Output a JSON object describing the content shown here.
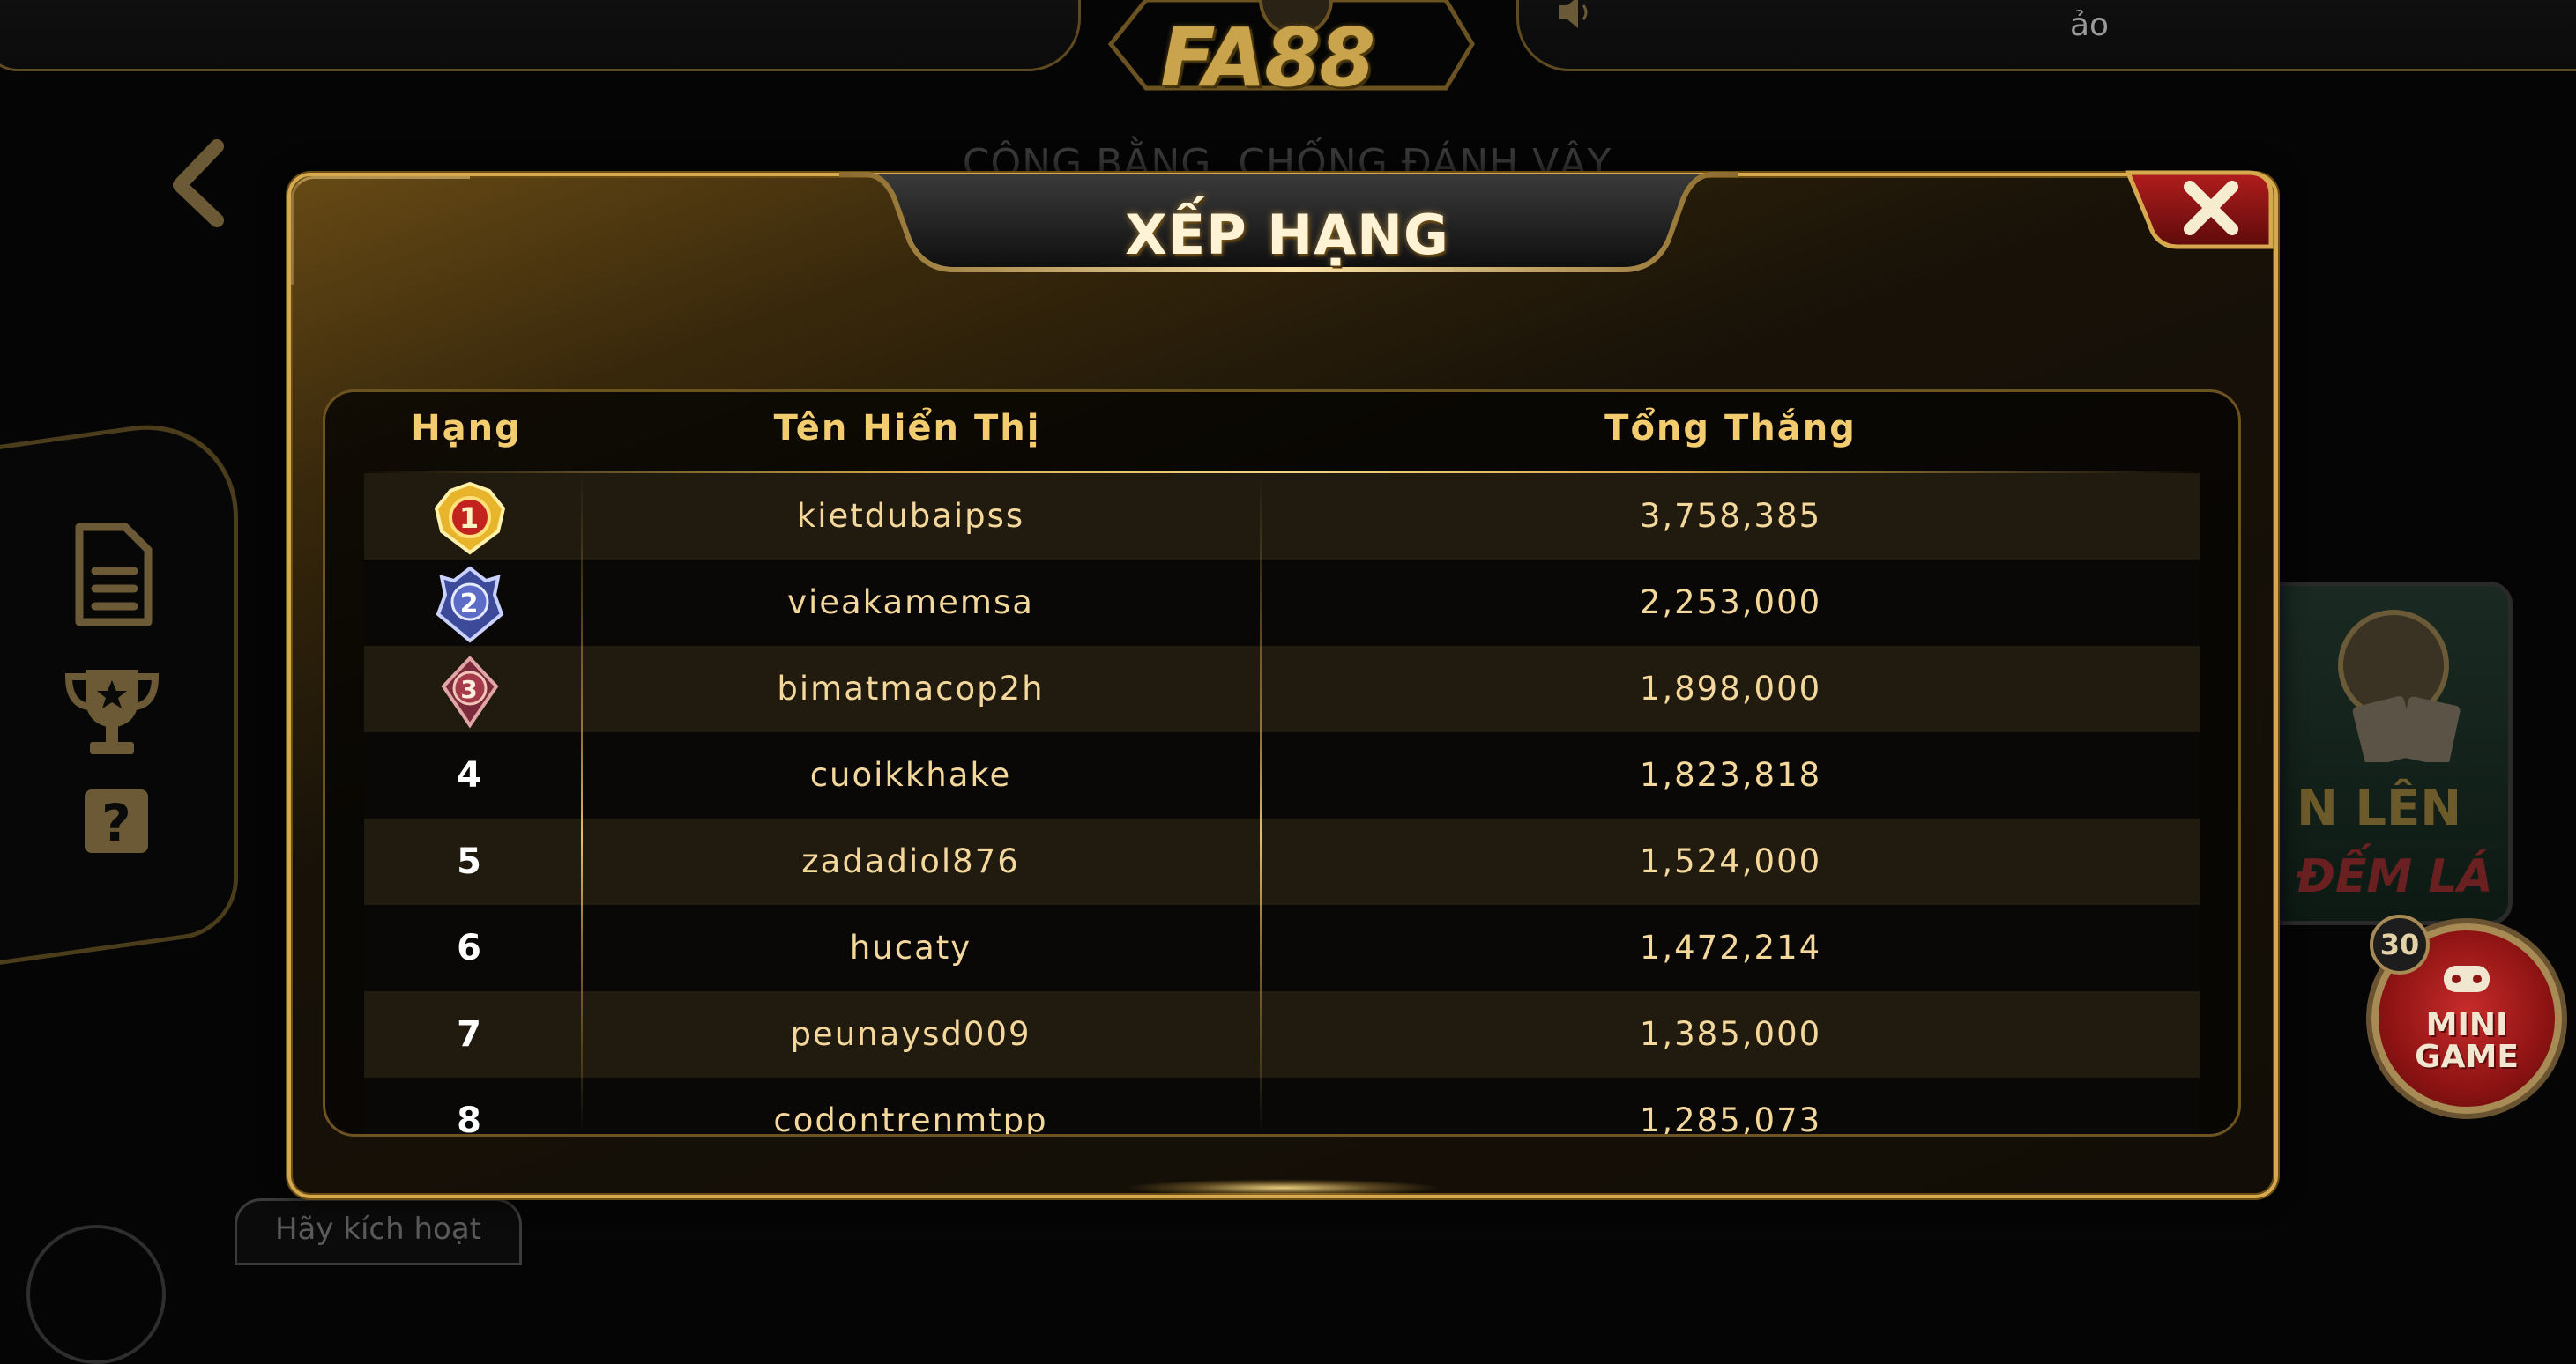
{
  "background": {
    "logo_text": "FA88",
    "slogan": "CÔNG BẰNG, CHỐNG ĐÁNH VẬY",
    "top_right_text": "ảo",
    "activate_label": "Hãy kích hoạt",
    "right_card_text1": "N LÊN",
    "right_card_text2": "ĐẾM LÁ",
    "minigame_label": "MINI GAME",
    "minigame_badge": "30"
  },
  "modal": {
    "title": "XẾP HẠNG",
    "columns": [
      "Hạng",
      "Tên Hiển Thị",
      "Tổng Thắng"
    ],
    "rows": [
      {
        "rank": "1",
        "medal": "gold-medal",
        "name": "kietdubaipss",
        "total": "3,758,385"
      },
      {
        "rank": "2",
        "medal": "silver-medal",
        "name": "vieakamemsa",
        "total": "2,253,000"
      },
      {
        "rank": "3",
        "medal": "bronze-medal",
        "name": "bimatmacop2h",
        "total": "1,898,000"
      },
      {
        "rank": "4",
        "medal": "",
        "name": "cuoikkhake",
        "total": "1,823,818"
      },
      {
        "rank": "5",
        "medal": "",
        "name": "zadadiol876",
        "total": "1,524,000"
      },
      {
        "rank": "6",
        "medal": "",
        "name": "hucaty",
        "total": "1,472,214"
      },
      {
        "rank": "7",
        "medal": "",
        "name": "peunaysd009",
        "total": "1,385,000"
      },
      {
        "rank": "8",
        "medal": "",
        "name": "codontrenmtpp",
        "total": "1,285,073"
      }
    ]
  },
  "colors": {
    "gold": "#d6a94f",
    "text_gold": "#f4d79a",
    "row_odd": "#211a0e",
    "row_even": "#090806"
  }
}
